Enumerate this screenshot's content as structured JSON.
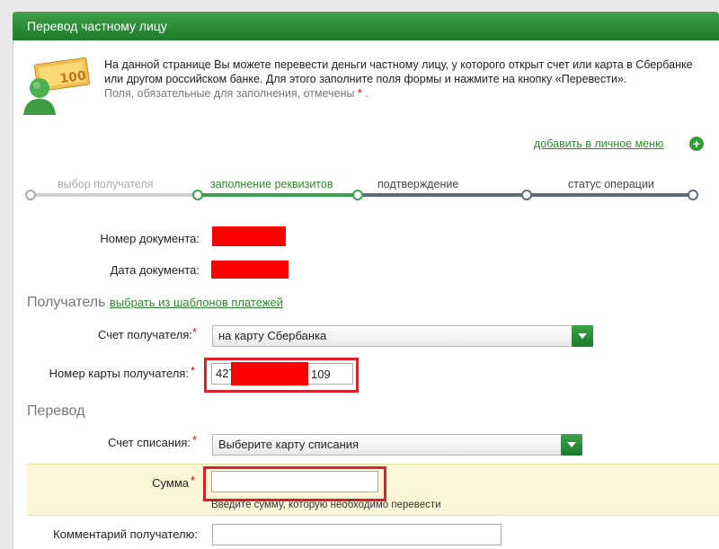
{
  "header": {
    "title": "Перевод частному лицу"
  },
  "intro": {
    "text": "На данной странице Вы можете перевести деньги частному лицу, у которого открыт счет или карта в Сбербанке или другом российском банке. Для этого заполните поля формы и нажмите на кнопку «Перевести».",
    "required_hint_prefix": "Поля, обязательные для заполнения, отмечены",
    "required_mark": "*",
    "required_hint_suffix": "."
  },
  "add_menu_label": "добавить в личное меню",
  "steps": [
    {
      "label": "выбор получателя"
    },
    {
      "label": "заполнение реквизитов"
    },
    {
      "label": "подтверждение"
    },
    {
      "label": "статус операции"
    }
  ],
  "document": {
    "number_label": "Номер документа:",
    "date_label": "Дата документа:"
  },
  "recipient": {
    "section_title": "Получатель",
    "templates_link": "выбрать из шаблонов платежей",
    "account_label": "Счет получателя:",
    "account_value": "на карту Сбербанка",
    "card_label": "Номер карты получателя:",
    "card_prefix": "427",
    "card_suffix": "109"
  },
  "transfer": {
    "section_title": "Перевод",
    "debit_label": "Счет списания:",
    "debit_value": "Выберите карту списания",
    "amount_label": "Сумма",
    "amount_value": "",
    "amount_hint": "Введите сумму, которую необходимо перевести",
    "comment_label": "Комментарий получателю:",
    "comment_value": ""
  },
  "colors": {
    "header_green": "#1d7a2a",
    "link_green": "#2d8a2d",
    "required_red": "#d00000",
    "highlight_red": "#d9202c",
    "redaction_red": "#ff0000",
    "amount_row_bg": "#fbf7d6"
  },
  "icons": [
    "money-transfer-icon",
    "plus-circle-icon",
    "dropdown-arrow-icon"
  ]
}
